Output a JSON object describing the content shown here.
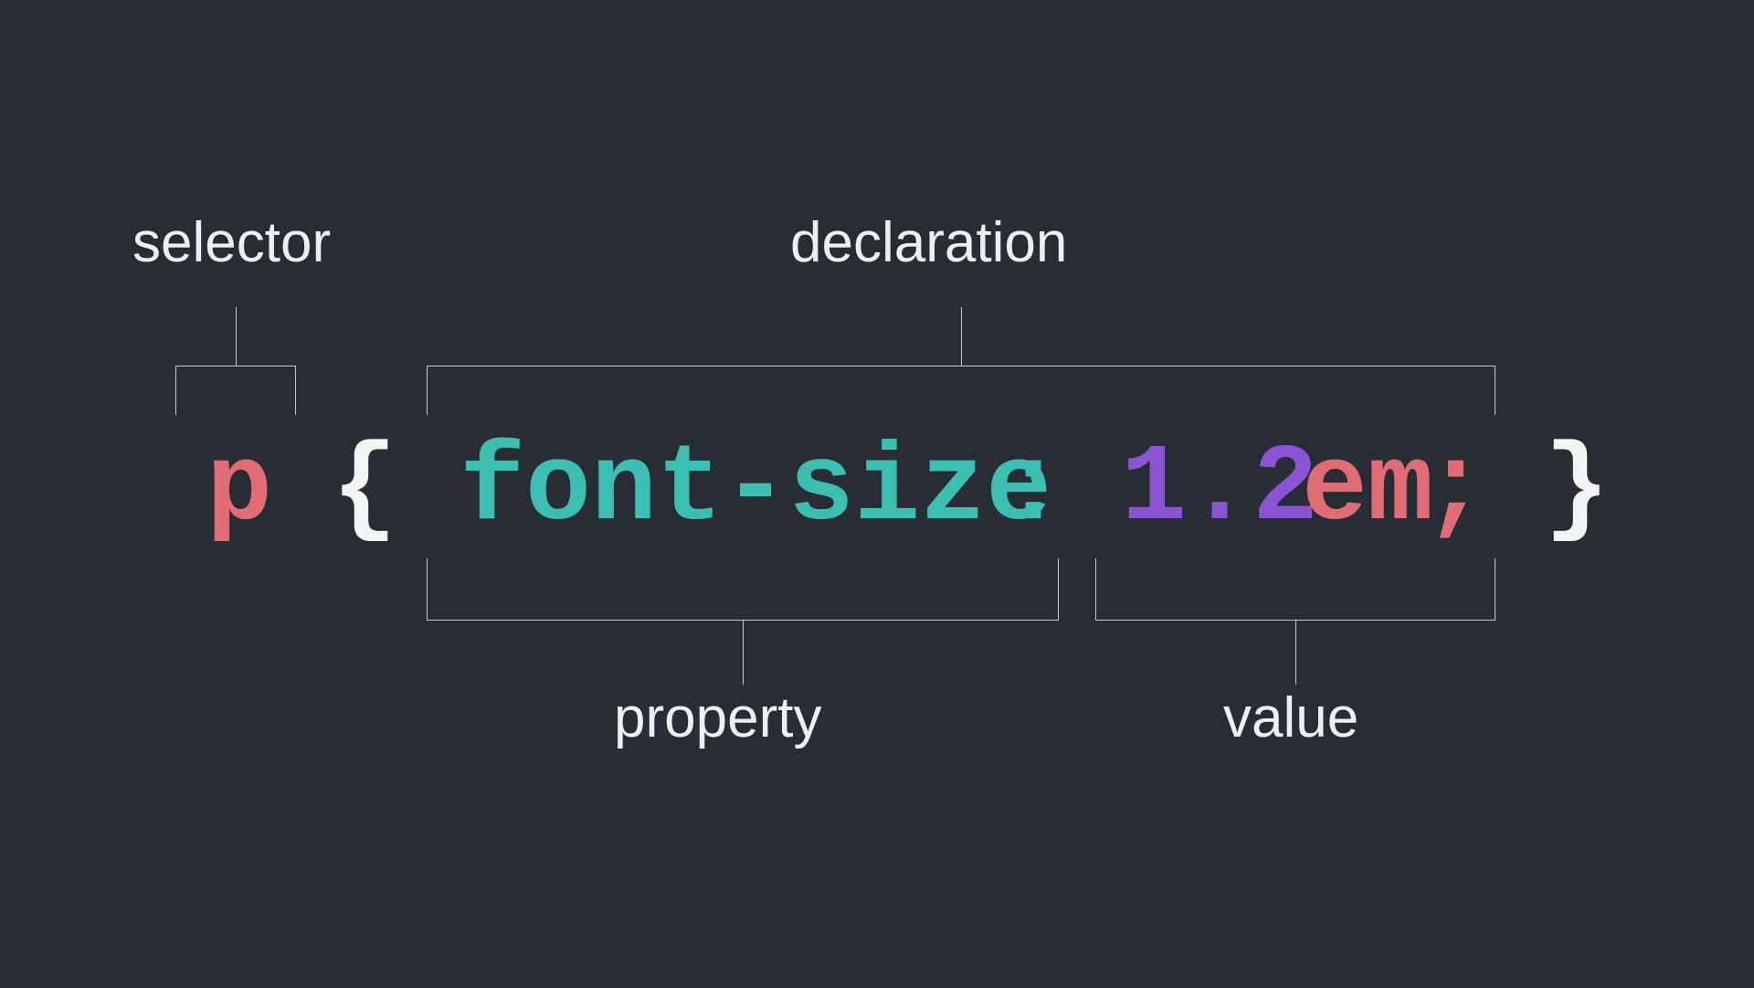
{
  "labels": {
    "selector": "selector",
    "declaration": "declaration",
    "property": "property",
    "value": "value"
  },
  "code": {
    "selector": "p",
    "brace_open": "{",
    "property": "font-size",
    "colon": ":",
    "number": "1.2",
    "unit": "em",
    "semicolon": ";",
    "brace_close": "}"
  },
  "colors": {
    "background": "#282c34",
    "text": "#eeeff0",
    "selector": "#e06c75",
    "brace": "#f3f4f4",
    "property": "#3cbfb2",
    "number": "#8a54d5",
    "unit": "#e06c75",
    "semicolon": "#e06c75",
    "line": "#c9cacc"
  }
}
